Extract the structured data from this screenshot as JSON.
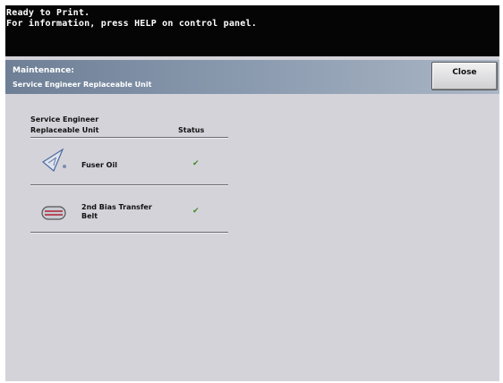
{
  "status": {
    "line1": "Ready to Print.",
    "line2": "For information, press HELP on control panel."
  },
  "header": {
    "title": "Maintenance:",
    "subtitle": "Service Engineer Replaceable Unit",
    "close_label": "Close"
  },
  "table": {
    "column_unit_line1": "Service Engineer",
    "column_unit_line2": "Replaceable  Unit",
    "column_status": "Status",
    "rows": [
      {
        "label": "Fuser Oil",
        "label_line2": "",
        "status": "✔",
        "icon": "fuser-oil-icon"
      },
      {
        "label": "2nd Bias Transfer",
        "label_line2": "Belt",
        "status": "✔",
        "icon": "transfer-belt-icon"
      }
    ]
  },
  "colors": {
    "status_bar": "#050505",
    "background": "#d5d3da",
    "header_gradient_start": "#6e7f96",
    "header_gradient_end": "#aab6c5",
    "check_green": "#3e8a2e"
  }
}
